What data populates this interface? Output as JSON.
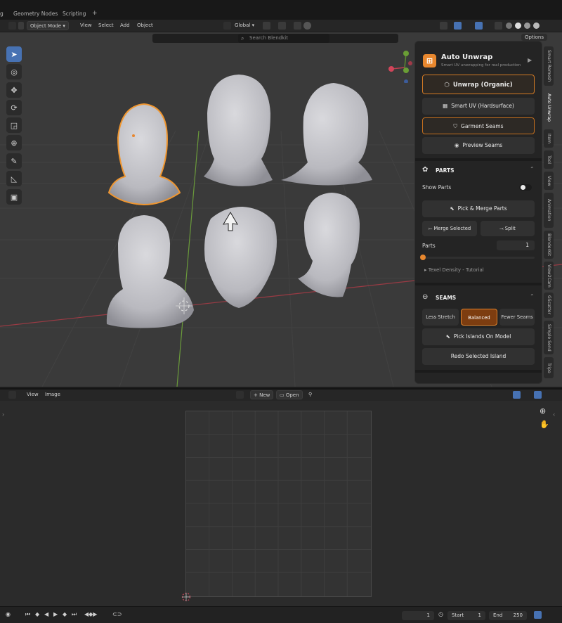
{
  "workspace_tabs": [
    "g",
    "Geometry Nodes",
    "Scripting"
  ],
  "viewport_header": {
    "mode": "Object Mode",
    "menus": [
      "View",
      "Select",
      "Add",
      "Object"
    ],
    "transform_orientation": "Global",
    "search_placeholder": "Search Blendkit",
    "options_label": "Options"
  },
  "addon_panel": {
    "title": "Auto Unwrap",
    "subtitle": "Smart UV unwrapping for real production",
    "buttons": {
      "unwrap_organic": "Unwrap (Organic)",
      "smart_uv": "Smart UV (Hardsurface)",
      "garment_seams": "Garment Seams",
      "preview_seams": "Preview Seams"
    },
    "parts": {
      "header": "PARTS",
      "show_parts_label": "Show Parts",
      "show_parts_on": true,
      "pick_merge": "Pick & Merge Parts",
      "merge_selected": "Merge Selected",
      "split": "Split",
      "parts_label": "Parts",
      "parts_value": "1",
      "texel_density": "Texel Density - Tutorial"
    },
    "seams": {
      "header": "SEAMS",
      "options": [
        "Less Stretch",
        "Balanced",
        "Fewer Seams"
      ],
      "selected": "Balanced",
      "pick_islands": "Pick Islands On Model",
      "redo_island": "Redo Selected Island"
    }
  },
  "sidebar_tabs": [
    "Smart Remesh",
    "Auto Unwrap",
    "Item",
    "Tool",
    "View",
    "Animation",
    "BlenderKit",
    "View2Cam",
    "GScatter",
    "Simple Send",
    "Tripo"
  ],
  "active_sidebar_tab": "Auto Unwrap",
  "uv_header": {
    "menus": [
      "View",
      "Image"
    ],
    "new_label": "New",
    "open_label": "Open"
  },
  "timeline": {
    "current_frame": "1",
    "start_label": "Start",
    "start_value": "1",
    "end_label": "End",
    "end_value": "250"
  },
  "colors": {
    "accent_orange": "#e8872e",
    "selection_outline": "#f0962f",
    "active_tool_blue": "#4772b3",
    "viewport_bg": "#3a3a3a"
  }
}
